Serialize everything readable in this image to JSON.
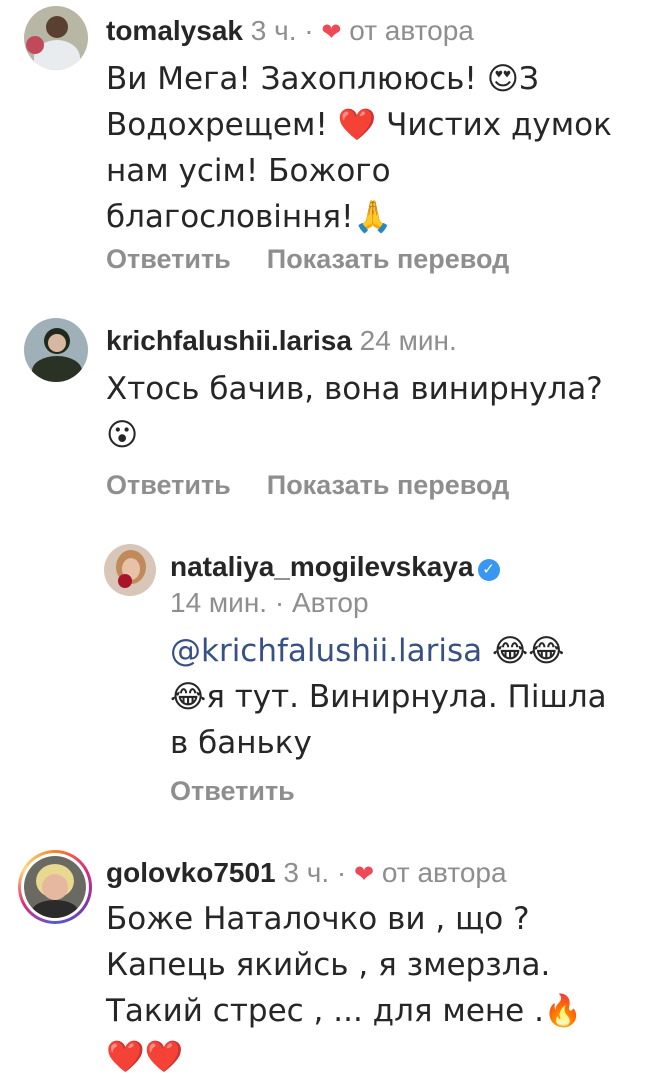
{
  "comments": [
    {
      "user": "tomalysak",
      "time": "3 ч.",
      "separator": "·",
      "heart_icon": "heart-icon",
      "liked_by": "от автора",
      "lines": [
        "Ви Мега! Захоплююсь! 😍З",
        "Водохрещем! ❤️ Чистих думок",
        "нам усім! Божого",
        "благословіння!🙏"
      ],
      "reply_label": "Ответить",
      "translate_label": "Показать перевод"
    },
    {
      "user": "krichfalushii.larisa",
      "time": "24 мин.",
      "lines": [
        "Хтось бачив, вона винирнула?",
        "😮"
      ],
      "reply_label": "Ответить",
      "translate_label": "Показать перевод"
    },
    {
      "user": "nataliya_mogilevskaya",
      "verified_icon": "verified-badge-icon",
      "time": "14 мин.",
      "separator": "·",
      "role": "Автор",
      "mention": "@krichfalushii.larisa",
      "mention_tail": " 😂😂",
      "lines": [
        "😂я тут. Винирнула. Пішла",
        "в баньку"
      ],
      "reply_label": "Ответить"
    },
    {
      "user": "golovko7501",
      "time": "3 ч.",
      "separator": "·",
      "heart_icon": "heart-icon",
      "liked_by": "от автора",
      "lines": [
        "Боже Наталочко ви , що ?",
        "Капець якийсь , я змерзла.",
        "Такий стрес , ... для мене .🔥",
        "❤️❤️"
      ]
    }
  ]
}
